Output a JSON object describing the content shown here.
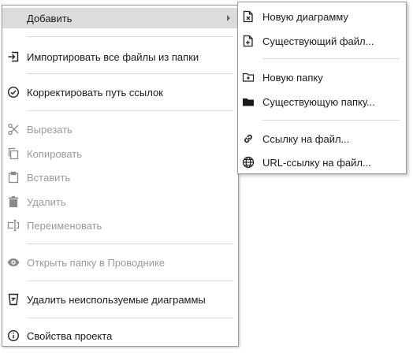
{
  "menu": {
    "items": [
      {
        "label": "Добавить",
        "icon": "none",
        "enabled": true,
        "highlighted": true,
        "has_submenu": true
      },
      {
        "label": "Импортировать все файлы из папки",
        "icon": "import-icon",
        "enabled": true
      },
      {
        "label": "Корректировать путь ссылок",
        "icon": "check-circle-icon",
        "enabled": true
      },
      {
        "label": "Вырезать",
        "icon": "scissors-icon",
        "enabled": false
      },
      {
        "label": "Копировать",
        "icon": "copy-icon",
        "enabled": false
      },
      {
        "label": "Вставить",
        "icon": "clipboard-icon",
        "enabled": false
      },
      {
        "label": "Удалить",
        "icon": "trash-icon",
        "enabled": false
      },
      {
        "label": "Переименовать",
        "icon": "rename-icon",
        "enabled": false
      },
      {
        "label": "Открыть папку в Проводнике",
        "icon": "eye-icon",
        "enabled": false
      },
      {
        "label": "Удалить неиспользуемые диаграммы",
        "icon": "bucket-icon",
        "enabled": true
      },
      {
        "label": "Свойства проекта",
        "icon": "info-icon",
        "enabled": true
      }
    ]
  },
  "submenu": {
    "items": [
      {
        "label": "Новую диаграмму",
        "icon": "new-diagram-icon",
        "enabled": true
      },
      {
        "label": "Существующий файл...",
        "icon": "file-add-icon",
        "enabled": true
      },
      {
        "label": "Новую папку",
        "icon": "folder-add-icon",
        "enabled": true
      },
      {
        "label": "Существующую папку...",
        "icon": "folder-icon",
        "enabled": true
      },
      {
        "label": "Ссылку на файл...",
        "icon": "link-icon",
        "enabled": true
      },
      {
        "label": "URL-ссылку на файл...",
        "icon": "globe-icon",
        "enabled": true
      }
    ]
  },
  "colors": {
    "highlight": "#dcdcdc",
    "disabled_text": "#9a9a9a",
    "separator": "#dadada"
  }
}
